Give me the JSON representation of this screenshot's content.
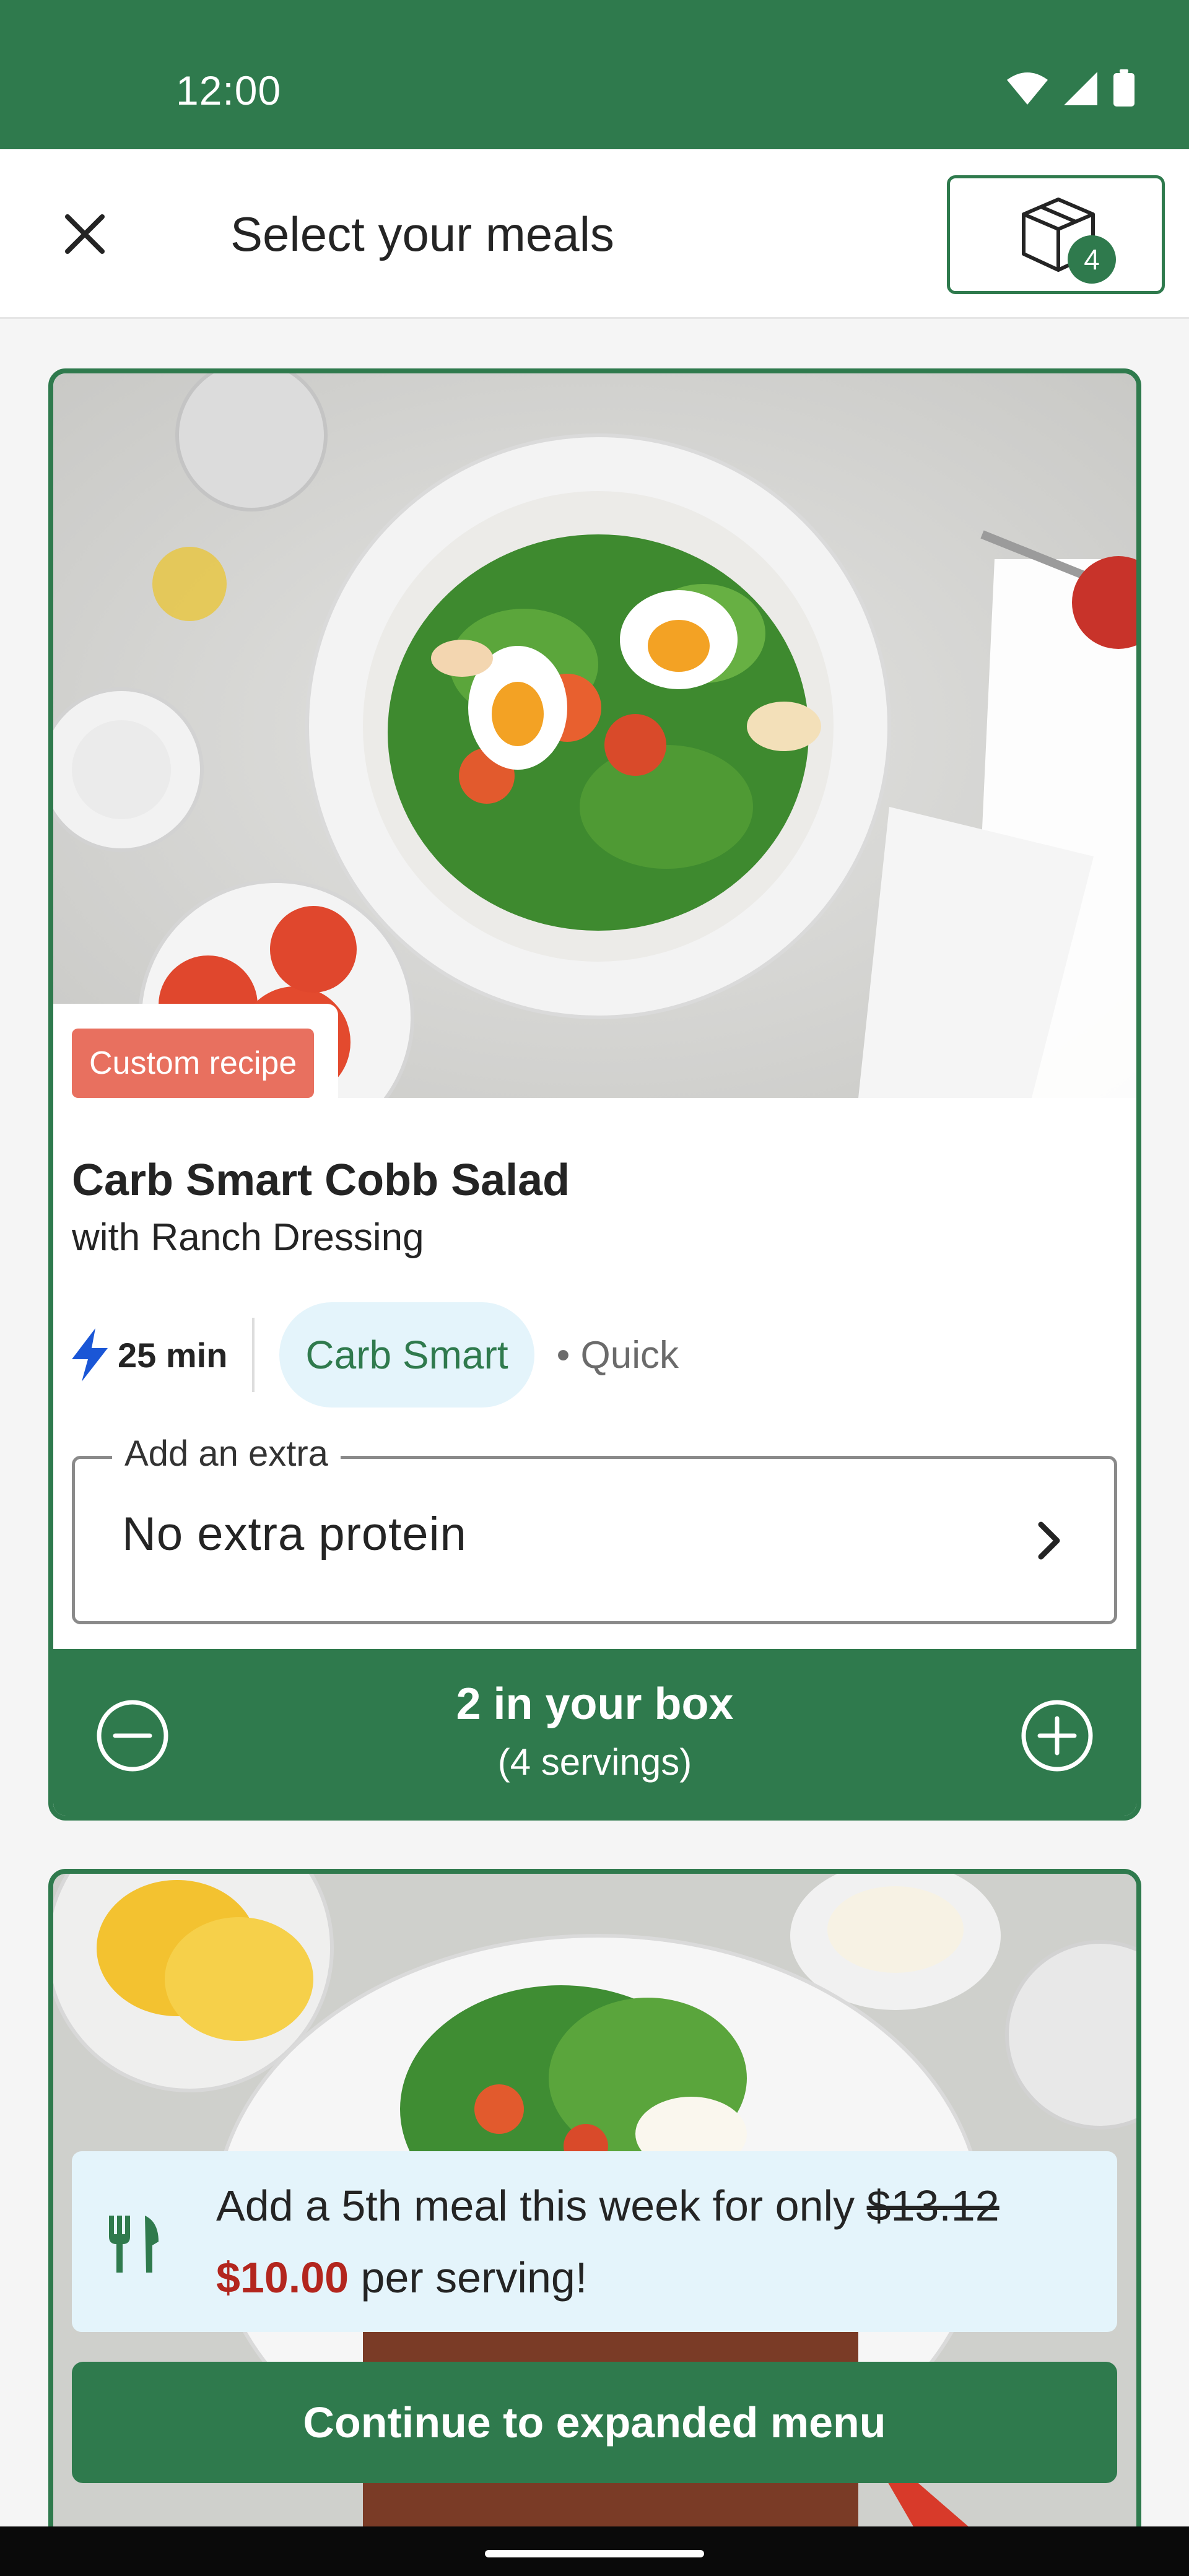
{
  "status_bar": {
    "time": "12:00",
    "icons": [
      "wifi-icon",
      "signal-icon",
      "battery-icon"
    ]
  },
  "app_bar": {
    "close_icon": "close-icon",
    "title": "Select your meals",
    "box_icon": "box-icon",
    "box_count": "4"
  },
  "recipe_card": {
    "badge": "Custom recipe",
    "title": "Carb Smart Cobb Salad",
    "subtitle": "with Ranch Dressing",
    "time": "25 min",
    "tag": "Carb Smart",
    "secondary_tag": "• Quick",
    "extra_label": "Add an extra",
    "extra_value": "No extra protein",
    "box_quantity": "2 in your box",
    "servings": "(4 servings)"
  },
  "promo_card": {
    "line1_prefix": "Add a 5th meal this week for only ",
    "old_price": "$13.12",
    "new_price": "$10.00",
    "line2_suffix": " per serving!",
    "cta": "Continue to expanded menu"
  },
  "colors": {
    "brand_green": "#2f7a4d",
    "badge_coral": "#e8705f",
    "light_blue": "#e4f4fb",
    "price_red": "#b3261e"
  }
}
